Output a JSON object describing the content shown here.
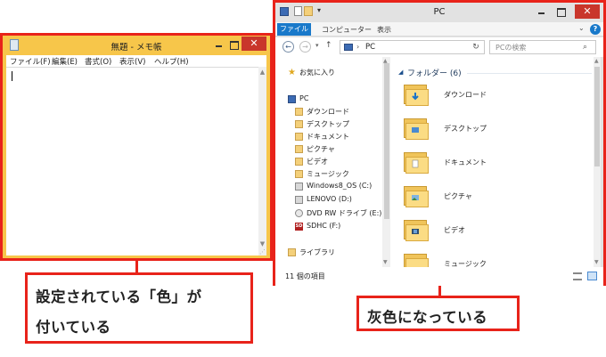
{
  "notepad": {
    "title": "無題 - メモ帳",
    "close_glyph": "✕",
    "menu": [
      "ファイル(F)",
      "編集(E)",
      "書式(O)",
      "表示(V)",
      "ヘルプ(H)"
    ],
    "frame_color": "#f7c64a"
  },
  "explorer": {
    "title": "PC",
    "close_glyph": "✕",
    "qat_dropdown": "▾",
    "ribbon_tabs": [
      "ファイル",
      "コンピューター",
      "表示"
    ],
    "help_glyph": "?",
    "address": "PC",
    "search_placeholder": "PCの検索",
    "nav_items": [
      {
        "label": "お気に入り",
        "icon": "star-icon"
      },
      {
        "label": "PC",
        "icon": "computer-icon"
      },
      {
        "label": "ダウンロード",
        "icon": "folder-icon"
      },
      {
        "label": "デスクトップ",
        "icon": "folder-icon"
      },
      {
        "label": "ドキュメント",
        "icon": "folder-icon"
      },
      {
        "label": "ピクチャ",
        "icon": "folder-icon"
      },
      {
        "label": "ビデオ",
        "icon": "folder-icon"
      },
      {
        "label": "ミュージック",
        "icon": "folder-icon"
      },
      {
        "label": "Windows8_OS (C:)",
        "icon": "drive-icon"
      },
      {
        "label": "LENOVO (D:)",
        "icon": "drive-icon"
      },
      {
        "label": "DVD RW ドライブ (E:)",
        "icon": "disc-icon"
      },
      {
        "label": "SDHC (F:)",
        "icon": "sd-card-icon"
      },
      {
        "label": "ライブラリ",
        "icon": "library-icon"
      }
    ],
    "group_title": "フォルダー (6)",
    "folders": [
      "ダウンロード",
      "デスクトップ",
      "ドキュメント",
      "ピクチャ",
      "ビデオ",
      "ミュージック"
    ],
    "status": "11 個の項目",
    "frame_color": "#e2e2e2",
    "accent": "#1979ca"
  },
  "callouts": {
    "left_line1": "設定されている「色」が",
    "left_line2": "付いている",
    "right": "灰色になっている",
    "color": "#e8231a"
  }
}
